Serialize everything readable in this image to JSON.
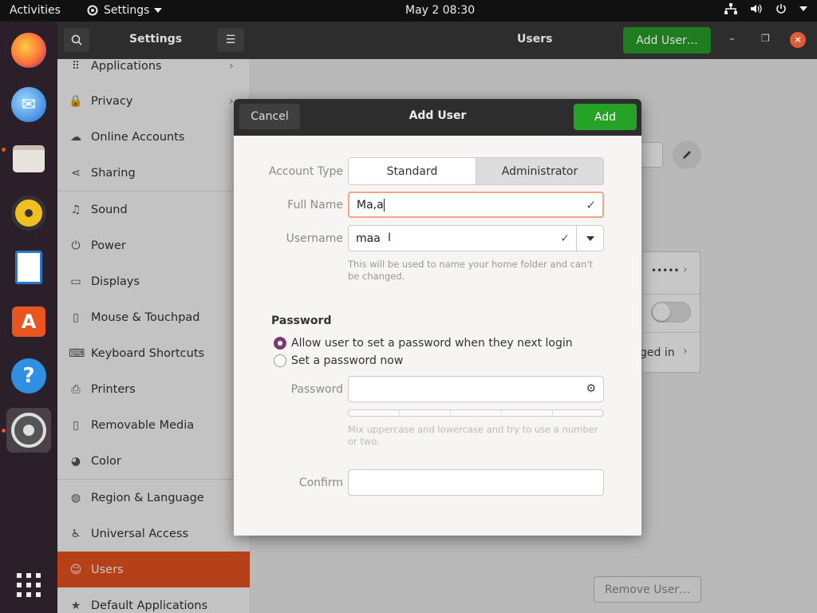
{
  "topbar": {
    "activities": "Activities",
    "app_name": "Settings",
    "clock": "May 2  08:30"
  },
  "headerbar": {
    "sidebar_title": "Settings",
    "panel_title": "Users",
    "add_user": "Add User…"
  },
  "sidebar": {
    "items": [
      {
        "label": "Applications",
        "icon": "grid-icon"
      },
      {
        "label": "Privacy",
        "icon": "lock-icon"
      },
      {
        "label": "Online Accounts",
        "icon": "cloud-icon"
      },
      {
        "label": "Sharing",
        "icon": "share-icon"
      },
      {
        "label": "Sound",
        "icon": "music-note-icon"
      },
      {
        "label": "Power",
        "icon": "power-icon"
      },
      {
        "label": "Displays",
        "icon": "display-icon"
      },
      {
        "label": "Mouse & Touchpad",
        "icon": "mouse-icon"
      },
      {
        "label": "Keyboard Shortcuts",
        "icon": "keyboard-icon"
      },
      {
        "label": "Printers",
        "icon": "printer-icon"
      },
      {
        "label": "Removable Media",
        "icon": "usb-icon"
      },
      {
        "label": "Color",
        "icon": "color-icon"
      },
      {
        "label": "Region & Language",
        "icon": "globe-icon"
      },
      {
        "label": "Universal Access",
        "icon": "accessibility-icon"
      },
      {
        "label": "Users",
        "icon": "users-icon"
      },
      {
        "label": "Default Applications",
        "icon": "star-icon"
      }
    ],
    "selected": "Users"
  },
  "main": {
    "password_mask": "•••••",
    "logged_in_text": "ged in",
    "remove_user": "Remove User…"
  },
  "dialog": {
    "title": "Add User",
    "cancel": "Cancel",
    "add": "Add",
    "account_type_label": "Account Type",
    "account_types": [
      "Standard",
      "Administrator"
    ],
    "account_type_selected": "Standard",
    "full_name_label": "Full Name",
    "full_name_value": "Ma,a",
    "username_label": "Username",
    "username_value": "maa",
    "username_hint": "This will be used to name your home folder and can't be changed.",
    "password_section": "Password",
    "password_options": [
      "Allow user to set a password when they next login",
      "Set a password now"
    ],
    "password_option_selected": "Allow user to set a password when they next login",
    "password_label": "Password",
    "password_hint": "Mix uppercase and lowercase and try to use a number or two.",
    "confirm_label": "Confirm"
  },
  "colors": {
    "accent": "#e95420",
    "add_button": "#26a226",
    "radio_selected": "#7a3a72"
  }
}
